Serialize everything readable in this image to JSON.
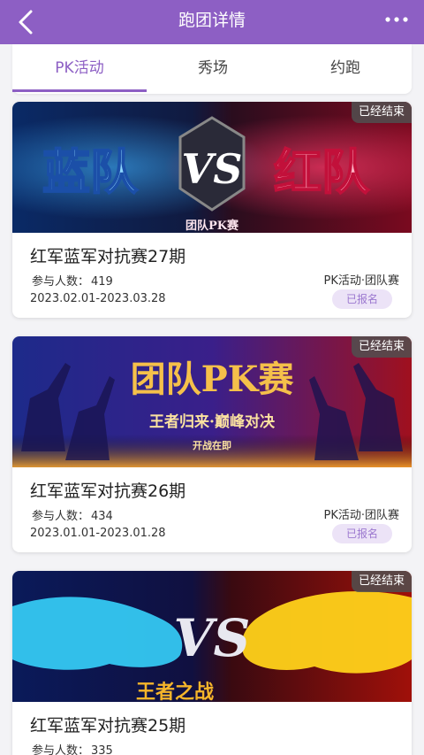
{
  "header": {
    "title": "跑团详情",
    "back_icon": "chevron-left-icon",
    "more_icon": "ellipsis-icon",
    "bg_color": "#8d5fc4"
  },
  "tabs": [
    {
      "label": "PK活动",
      "active": true
    },
    {
      "label": "秀场",
      "active": false
    },
    {
      "label": "约跑",
      "active": false
    }
  ],
  "cards": [
    {
      "banner": {
        "left_text": "蓝队",
        "vs_text": "VS",
        "right_text": "红队",
        "sub_text": "团队PK赛"
      },
      "badge": "已经结束",
      "title": "红军蓝军对抗赛27期",
      "participants_label": "参与人数：",
      "participants": "419",
      "type": "PK活动·团队赛",
      "date_range": "2023.02.01-2023.03.28",
      "status": "已报名"
    },
    {
      "banner": {
        "main_text": "团队PK赛",
        "tagline": "王者归来·巅峰对决",
        "sub_text": "开战在即"
      },
      "badge": "已经结束",
      "title": "红军蓝军对抗赛26期",
      "participants_label": "参与人数：",
      "participants": "434",
      "type": "PK活动·团队赛",
      "date_range": "2023.01.01-2023.01.28",
      "status": "已报名"
    },
    {
      "banner": {
        "vs_text": "VS",
        "sub_text": "王者之战"
      },
      "badge": "已经结束",
      "title": "红军蓝军对抗赛25期",
      "participants_label": "参与人数：",
      "participants": "335"
    }
  ]
}
